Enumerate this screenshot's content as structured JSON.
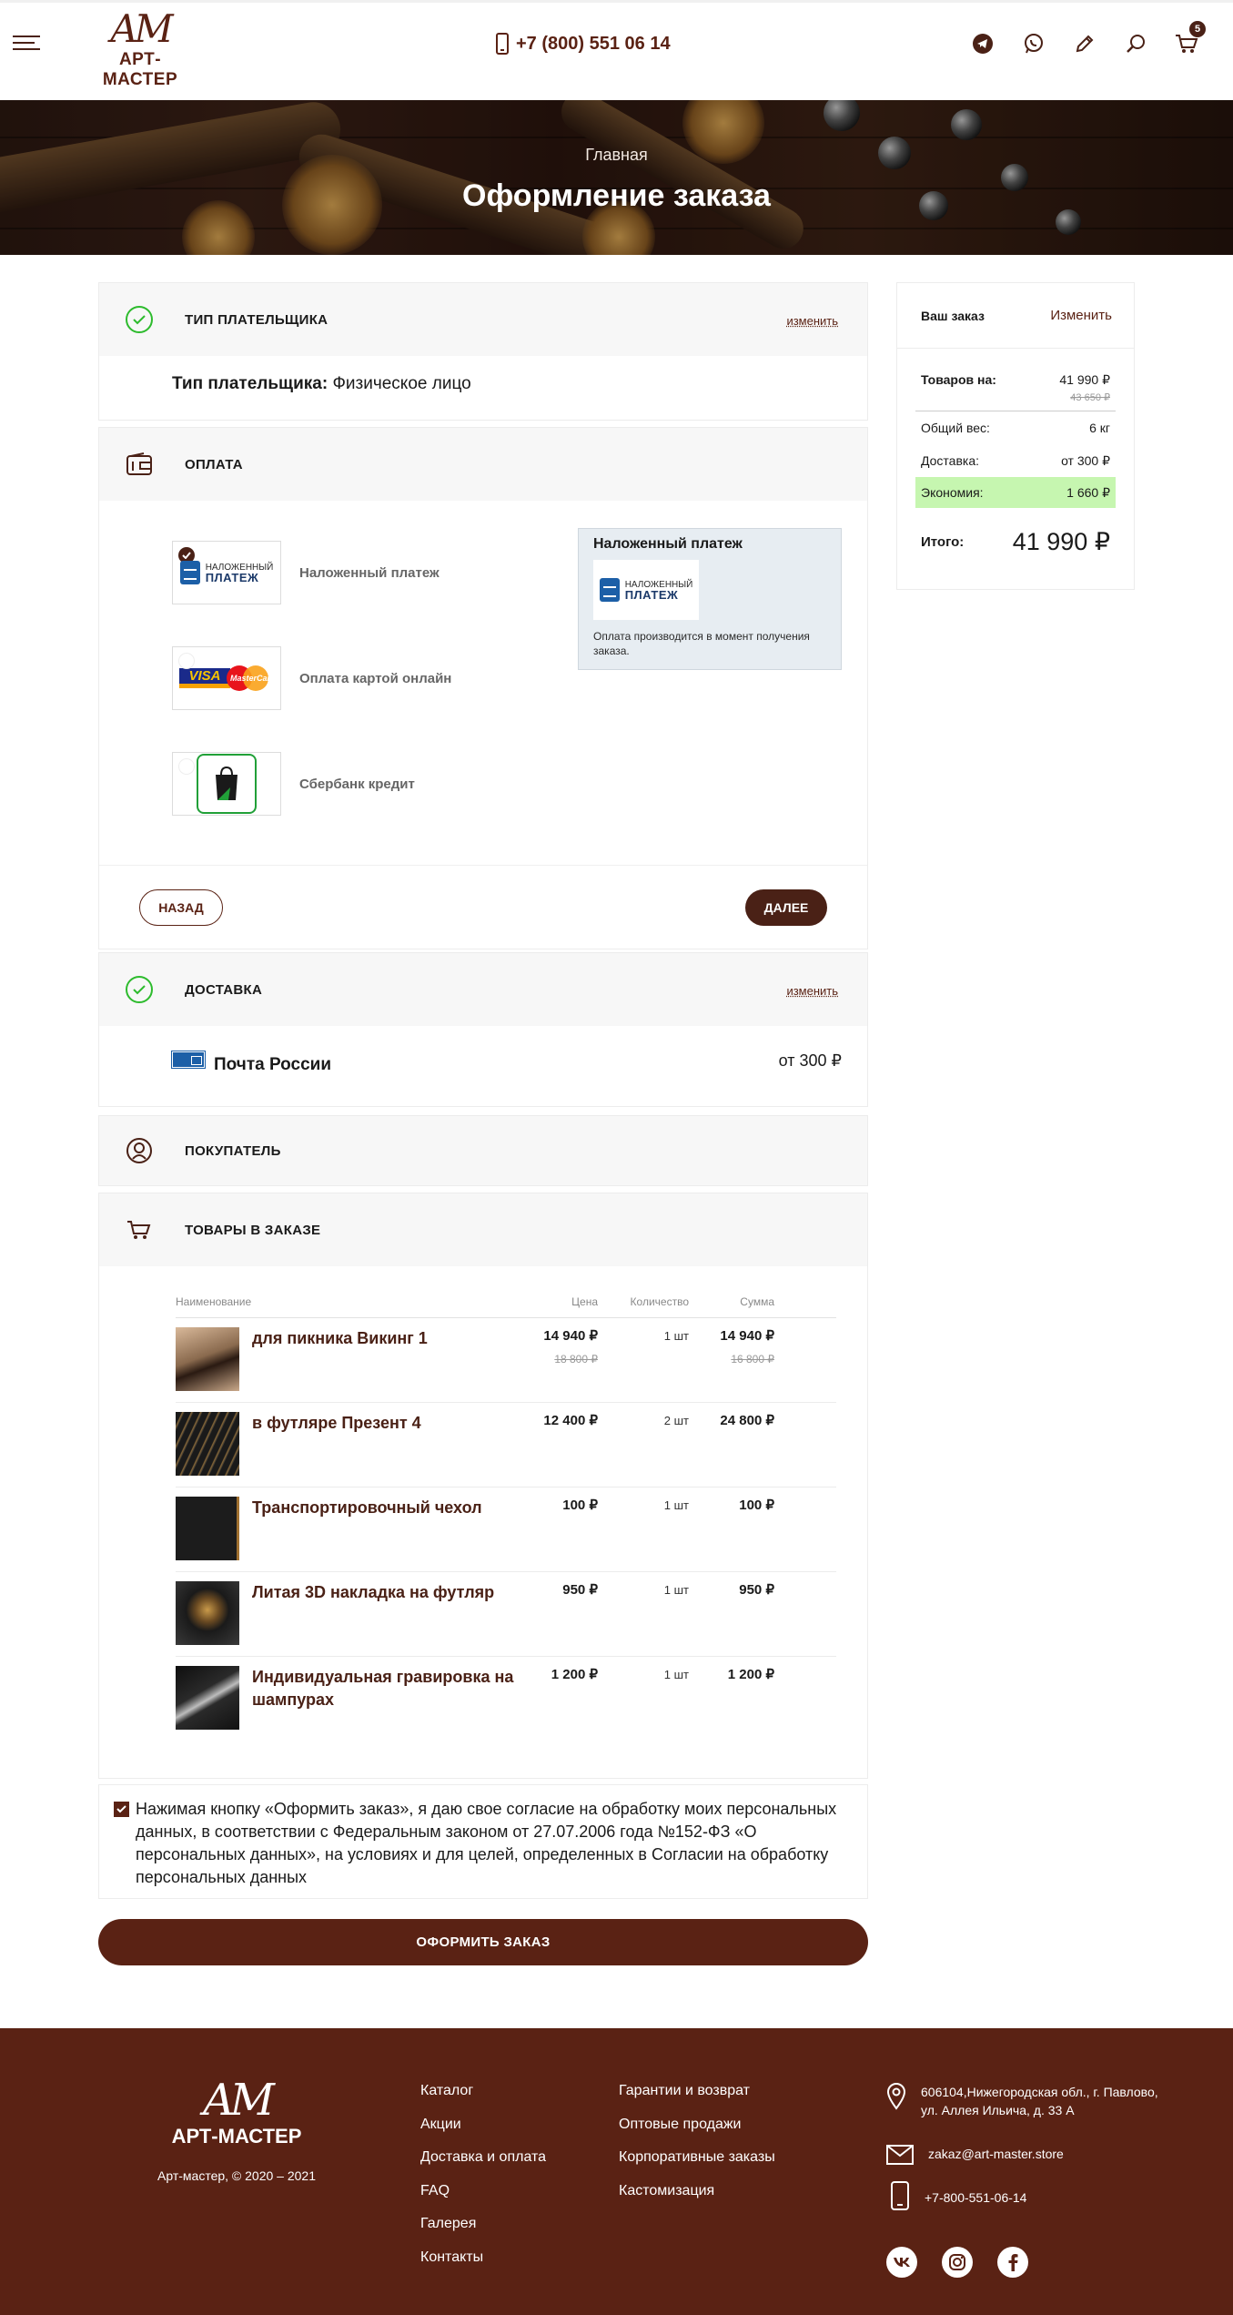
{
  "header": {
    "logo_mark": "AM",
    "logo_name": "АРТ-МАСТЕР",
    "phone": "+7 (800) 551 06 14",
    "cart_count": "5"
  },
  "hero": {
    "breadcrumb": "Главная",
    "title": "Оформление заказа"
  },
  "payer": {
    "title": "ТИП ПЛАТЕЛЬЩИКА",
    "edit": "изменить",
    "label": "Тип плательщика:",
    "value": "Физическое лицо"
  },
  "payment": {
    "title": "ОПЛАТА",
    "options": [
      {
        "label": "Наложенный платеж",
        "selected": true
      },
      {
        "label": "Оплата картой онлайн",
        "selected": false
      },
      {
        "label": "Сбербанк кредит",
        "selected": false
      }
    ],
    "np_logo_small": "НАЛОЖЕННЫЙ",
    "np_logo_big": "ПЛАТЕЖ",
    "visa": "VISA",
    "mastercard": "MasterCard",
    "info_title": "Наложенный платеж",
    "info_text": "Оплата производится в момент получения заказа.",
    "back": "НАЗАД",
    "next": "ДАЛЕЕ"
  },
  "delivery": {
    "title": "ДОСТАВКА",
    "edit": "изменить",
    "name": "Почта России",
    "price": "от 300 ₽"
  },
  "buyer": {
    "title": "ПОКУПАТЕЛЬ"
  },
  "goods": {
    "title": "ТОВАРЫ В ЗАКАЗЕ",
    "columns": {
      "name": "Наименование",
      "price": "Цена",
      "qty": "Количество",
      "sum": "Сумма"
    },
    "items": [
      {
        "name": "для пикника Викинг 1",
        "price": "14 940 ₽",
        "old_price": "18 800 ₽",
        "qty": "1 шт",
        "sum": "14 940 ₽",
        "old_sum": "16 800 ₽"
      },
      {
        "name": "в футляре Презент 4",
        "price": "12 400 ₽",
        "old_price": "",
        "qty": "2 шт",
        "sum": "24 800 ₽",
        "old_sum": ""
      },
      {
        "name": "Транспортировочный чехол",
        "price": "100 ₽",
        "old_price": "",
        "qty": "1 шт",
        "sum": "100 ₽",
        "old_sum": ""
      },
      {
        "name": "Литая 3D накладка на футляр",
        "price": "950 ₽",
        "old_price": "",
        "qty": "1 шт",
        "sum": "950 ₽",
        "old_sum": ""
      },
      {
        "name": "Индивидуальная гравировка на шампурах",
        "price": "1 200 ₽",
        "old_price": "",
        "qty": "1 шт",
        "sum": "1 200 ₽",
        "old_sum": ""
      }
    ]
  },
  "consent": {
    "checked": true,
    "text": "Нажимая кнопку «Оформить заказ», я даю свое согласие на обработку моих персональных данных, в соответствии с Федеральным законом от 27.07.2006 года №152-ФЗ «О персональных данных», на условиях и для целей, определенных в Согласии на обработку персональных данных"
  },
  "submit": "ОФОРМИТЬ ЗАКАЗ",
  "summary": {
    "title": "Ваш заказ",
    "edit": "Изменить",
    "goods_label": "Товаров на:",
    "goods_value": "41 990 ₽",
    "goods_old": "43 650 ₽",
    "weight_label": "Общий вес:",
    "weight_value": "6 кг",
    "delivery_label": "Доставка:",
    "delivery_value": "от 300 ₽",
    "saving_label": "Экономия:",
    "saving_value": "1 660 ₽",
    "total_label": "Итого:",
    "total_value": "41 990 ₽"
  },
  "footer": {
    "logo_mark": "AM",
    "logo_name": "АРТ-МАСТЕР",
    "copyright": "Арт-мастер, © 2020 – 2021",
    "col1": [
      "Каталог",
      "Акции",
      "Доставка и оплата",
      "FAQ",
      "Галерея",
      "Контакты"
    ],
    "col2": [
      "Гарантии и возврат",
      "Оптовые продажи",
      "Корпоративные заказы",
      "Кастомизация"
    ],
    "address_line1": "606104,Нижегородская обл., г. Павлово,",
    "address_line2": "ул. Аллея Ильича, д. 33 А",
    "email": "zakaz@art-master.store",
    "phone": "+7-800-551-06-14"
  },
  "colors": {
    "brand": "#5a2214",
    "accent_green": "#2dbb2d",
    "saving_bg": "#c6f6b0"
  }
}
